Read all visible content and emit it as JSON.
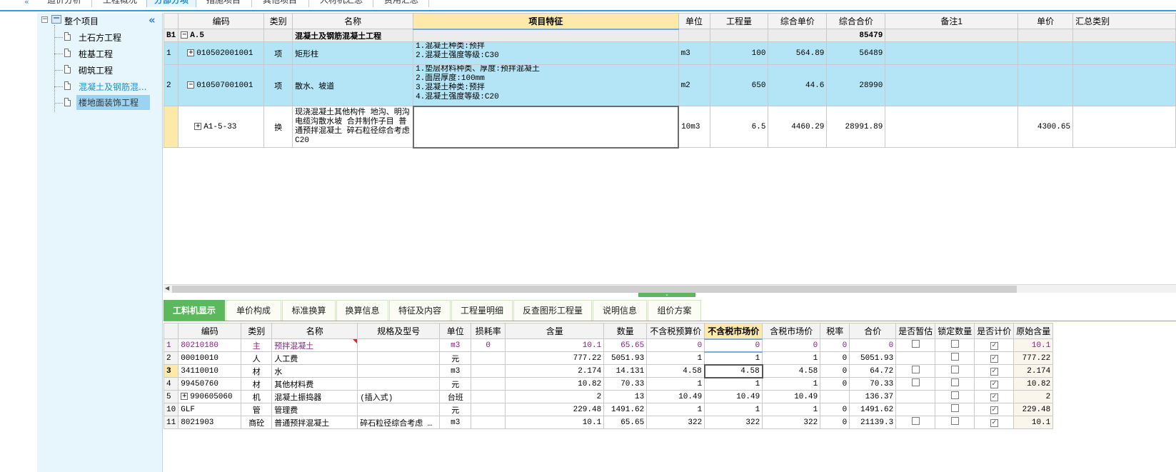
{
  "top_tabs": [
    {
      "label": "造价分析"
    },
    {
      "label": "工程概况"
    },
    {
      "label": "分部分项"
    },
    {
      "label": "措施项目"
    },
    {
      "label": "其他项目"
    },
    {
      "label": "人材机汇总"
    },
    {
      "label": "费用汇总"
    }
  ],
  "tree": {
    "root": "整个项目",
    "items": [
      {
        "label": "土石方工程"
      },
      {
        "label": "桩基工程"
      },
      {
        "label": "砌筑工程"
      },
      {
        "label": "混凝土及钢筋混..."
      },
      {
        "label": "楼地面装饰工程"
      }
    ],
    "collapse_icon": "chevron-double-left-icon"
  },
  "upper_grid": {
    "headers": [
      "编码",
      "类别",
      "名称",
      "项目特征",
      "单位",
      "工程量",
      "综合单价",
      "综合合价",
      "备注1",
      "单价",
      "汇总类别"
    ],
    "section": {
      "idx": "B1",
      "code": "A.5",
      "name": "混凝土及钢筋混凝土工程",
      "total": "85479"
    },
    "rows": [
      {
        "idx": "1",
        "code": "010502001001",
        "type": "项",
        "name": "矩形柱",
        "feature": "1.混凝土种类:预拌\n2.混凝土强度等级:C30",
        "unit": "m3",
        "qty": "100",
        "price": "564.89",
        "total": "56489",
        "remark": "",
        "unit_price": ""
      },
      {
        "idx": "2",
        "code": "010507001001",
        "type": "项",
        "name": "散水、坡道",
        "feature": "1.垫层材料种类、厚度:预拌混凝土\n2.面层厚度:100mm\n3.混凝土种类:预拌\n4.混凝土强度等级:C20",
        "unit": "m2",
        "qty": "650",
        "price": "44.6",
        "total": "28990",
        "remark": "",
        "unit_price": ""
      },
      {
        "idx": "",
        "code": "A1-5-33",
        "type": "换",
        "name": "现浇混凝土其他构件 地沟、明沟电缆沟散水坡  合并制作子目 普通预拌混凝土 碎石粒径综合考虑 C20",
        "feature": "",
        "unit": "10m3",
        "qty": "6.5",
        "price": "4460.29",
        "total": "28991.89",
        "remark": "",
        "unit_price": "4300.65"
      }
    ]
  },
  "lower_tabs": [
    "工料机显示",
    "单价构成",
    "标准换算",
    "换算信息",
    "特征及内容",
    "工程量明细",
    "反查图形工程量",
    "说明信息",
    "组价方案"
  ],
  "lower_grid": {
    "headers": [
      "编码",
      "类别",
      "名称",
      "规格及型号",
      "单位",
      "损耗率",
      "含量",
      "数量",
      "不含税预算价",
      "不含税市场价",
      "含税市场价",
      "税率",
      "合价",
      "是否暂估",
      "锁定数量",
      "是否计价",
      "原始含量"
    ],
    "rows": [
      {
        "idx": "1",
        "code": "80210180",
        "type": "主",
        "name": "预拌混凝土",
        "spec": "",
        "unit": "m3",
        "loss": "0",
        "content": "10.1",
        "qty": "65.65",
        "budget": "0",
        "market": "0",
        "market_tax": "0",
        "rate": "0",
        "total": "0",
        "est": "unchecked",
        "lock": "unchecked",
        "priced": "checked",
        "orig": "10.1"
      },
      {
        "idx": "2",
        "code": "00010010",
        "type": "人",
        "name": "人工费",
        "spec": "",
        "unit": "元",
        "loss": "",
        "content": "777.22",
        "qty": "5051.93",
        "budget": "1",
        "market": "1",
        "market_tax": "1",
        "rate": "0",
        "total": "5051.93",
        "est": "",
        "lock": "unchecked",
        "priced": "checked",
        "orig": "777.22"
      },
      {
        "idx": "3",
        "code": "34110010",
        "type": "材",
        "name": "水",
        "spec": "",
        "unit": "m3",
        "loss": "",
        "content": "2.174",
        "qty": "14.131",
        "budget": "4.58",
        "market": "4.58",
        "market_tax": "4.58",
        "rate": "0",
        "total": "64.72",
        "est": "unchecked",
        "lock": "unchecked",
        "priced": "checked",
        "orig": "2.174"
      },
      {
        "idx": "4",
        "code": "99450760",
        "type": "材",
        "name": "其他材料费",
        "spec": "",
        "unit": "元",
        "loss": "",
        "content": "10.82",
        "qty": "70.33",
        "budget": "1",
        "market": "1",
        "market_tax": "1",
        "rate": "0",
        "total": "70.33",
        "est": "unchecked",
        "lock": "unchecked",
        "priced": "checked",
        "orig": "10.82"
      },
      {
        "idx": "5",
        "code": "990605060",
        "type": "机",
        "name": "混凝土振捣器",
        "spec": "(插入式)",
        "unit": "台班",
        "loss": "",
        "content": "2",
        "qty": "13",
        "budget": "10.49",
        "market": "10.49",
        "market_tax": "10.49",
        "rate": "",
        "total": "136.37",
        "est": "",
        "lock": "unchecked",
        "priced": "checked",
        "orig": "2"
      },
      {
        "idx": "10",
        "code": "GLF",
        "type": "管",
        "name": "管理费",
        "spec": "",
        "unit": "元",
        "loss": "",
        "content": "229.48",
        "qty": "1491.62",
        "budget": "1",
        "market": "1",
        "market_tax": "1",
        "rate": "0",
        "total": "1491.62",
        "est": "",
        "lock": "unchecked",
        "priced": "checked",
        "orig": "229.48"
      },
      {
        "idx": "11",
        "code": "8021903",
        "type": "商砼",
        "name": "普通预拌混凝土",
        "spec": "碎石粒径综合考虑 …",
        "unit": "m3",
        "loss": "",
        "content": "10.1",
        "qty": "65.65",
        "budget": "322",
        "market": "322",
        "market_tax": "322",
        "rate": "0",
        "total": "21139.3",
        "est": "unchecked",
        "lock": "unchecked",
        "priced": "checked",
        "orig": "10.1"
      }
    ]
  },
  "colors": {
    "accent_blue": "#1a8fd0",
    "item_row_bg": "#b3e5f6",
    "header_highlight": "#fde9a8",
    "tab_active_green": "#5cb85c",
    "main_material_text": "#8b1a8b"
  }
}
